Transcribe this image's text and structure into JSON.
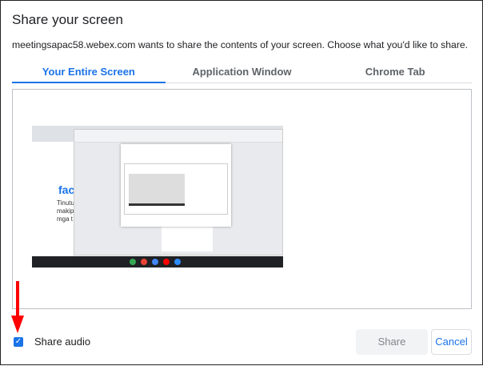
{
  "dialog": {
    "title": "Share your screen",
    "subtitle": "meetingsapac58.webex.com wants to share the contents of your screen. Choose what you'd like to share.",
    "tabs": [
      {
        "label": "Your Entire Screen",
        "active": true
      },
      {
        "label": "Application Window"
      },
      {
        "label": "Chrome Tab"
      }
    ],
    "preview": {
      "fac": "fac",
      "lines": [
        "Tinutu",
        "makip",
        "mga t"
      ]
    },
    "share_audio": {
      "label": "Share audio",
      "checked": true
    },
    "share_button": "Share",
    "cancel_button": "Cancel"
  },
  "colors": {
    "accent": "#1a73e8",
    "annotation_arrow": "#ff0000"
  }
}
